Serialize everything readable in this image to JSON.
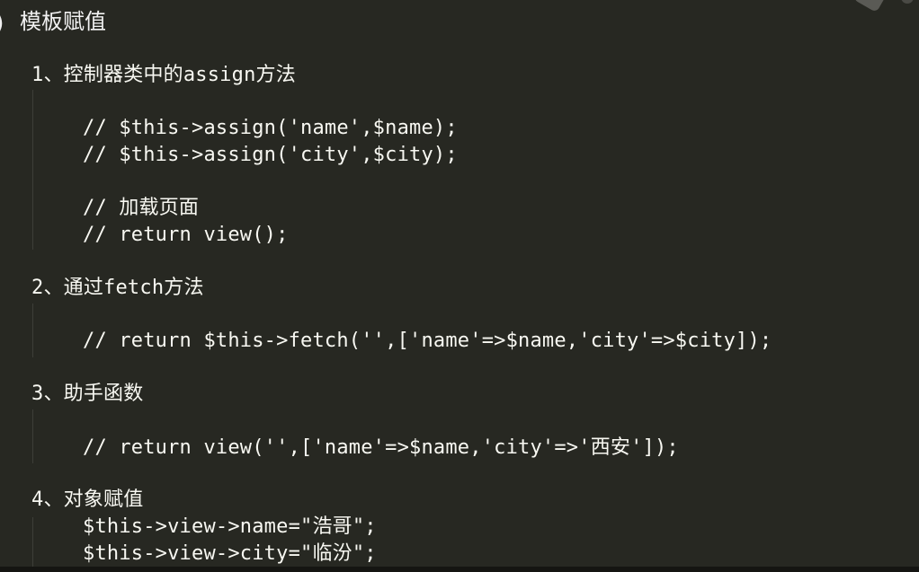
{
  "heading": {
    "bullet": ")",
    "title": "模板赋值"
  },
  "sections": [
    {
      "label": "1、控制器类中的assign方法",
      "lines": [
        "// $this->assign('name',$name);",
        "// $this->assign('city',$city);",
        "",
        "// 加载页面",
        "// return view();"
      ]
    },
    {
      "label": "2、通过fetch方法",
      "lines": [
        "// return $this->fetch('',['name'=>$name,'city'=>$city]);"
      ]
    },
    {
      "label": "3、助手函数",
      "lines": [
        "// return view('',['name'=>$name,'city'=>'西安']);"
      ]
    },
    {
      "label": "4、对象赋值",
      "lines": [
        "$this->view->name=\"浩哥\";",
        "$this->view->city=\"临汾\";"
      ]
    }
  ]
}
